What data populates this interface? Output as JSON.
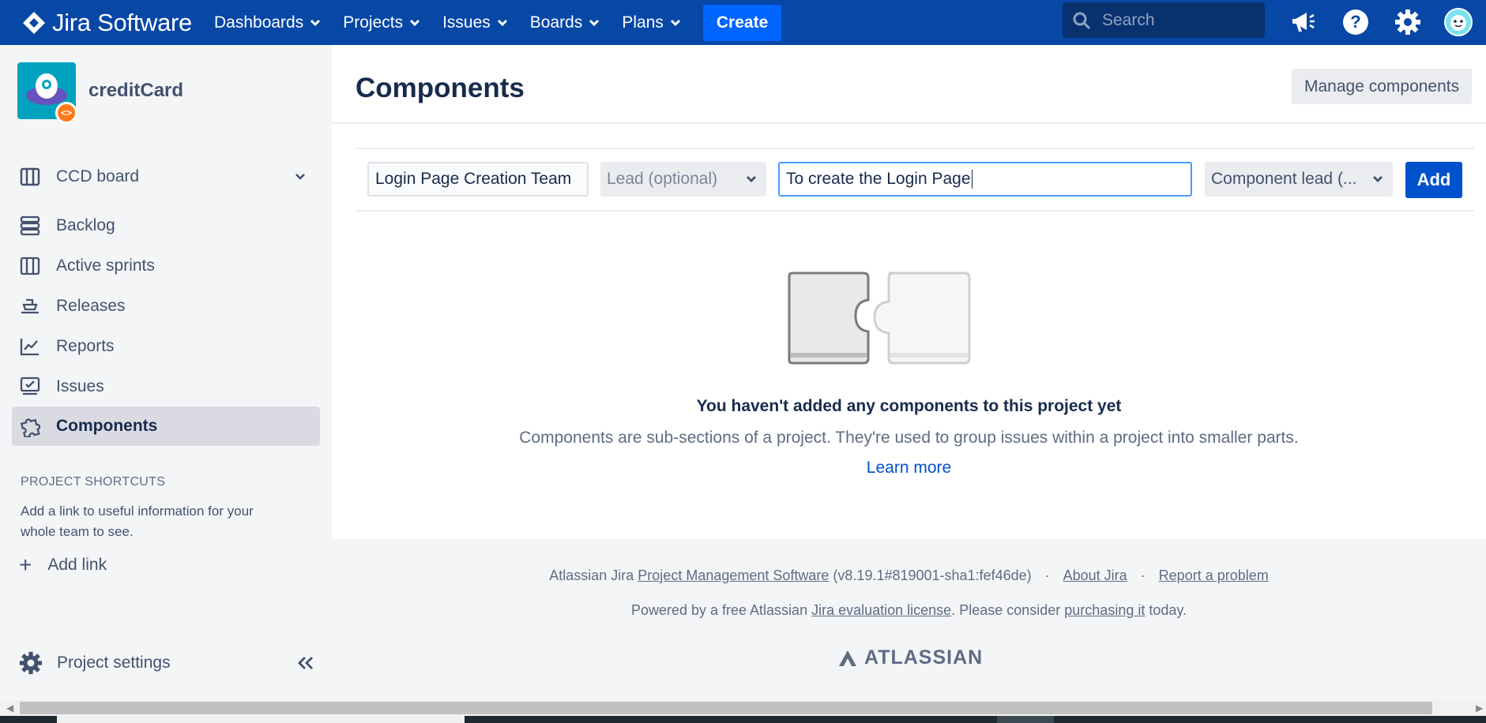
{
  "topnav": {
    "logo_text": "Jira Software",
    "menu": [
      {
        "label": "Dashboards"
      },
      {
        "label": "Projects"
      },
      {
        "label": "Issues"
      },
      {
        "label": "Boards"
      },
      {
        "label": "Plans"
      }
    ],
    "create_label": "Create",
    "search_placeholder": "Search"
  },
  "sidebar": {
    "project_name": "creditCard",
    "board_label": "CCD board",
    "items": [
      {
        "label": "Backlog",
        "icon": "backlog-icon"
      },
      {
        "label": "Active sprints",
        "icon": "sprint-board-icon"
      },
      {
        "label": "Releases",
        "icon": "ship-icon"
      },
      {
        "label": "Reports",
        "icon": "chart-icon"
      },
      {
        "label": "Issues",
        "icon": "issues-icon"
      },
      {
        "label": "Components",
        "icon": "puzzle-icon",
        "active": true
      }
    ],
    "shortcuts_title": "PROJECT SHORTCUTS",
    "shortcuts_desc": "Add a link to useful information for your whole team to see.",
    "add_link_label": "Add link",
    "settings_label": "Project settings"
  },
  "main": {
    "title": "Components",
    "manage_label": "Manage components",
    "form": {
      "name_value": "Login Page Creation Team",
      "lead_placeholder": "Lead (optional)",
      "description_value": "To create the Login Page",
      "component_lead_label": "Component lead (...",
      "add_label": "Add"
    },
    "empty": {
      "title": "You haven't added any components to this project yet",
      "description": "Components are sub-sections of a project. They're used to group issues within a project into smaller parts.",
      "learn_more": "Learn more"
    }
  },
  "footer": {
    "line1_prefix": "Atlassian Jira ",
    "line1_link1": "Project Management Software",
    "line1_version": " (v8.19.1#819001-sha1:fef46de)",
    "sep": " · ",
    "about_label": "About Jira",
    "report_label": "Report a problem",
    "line2_prefix": "Powered by a free Atlassian ",
    "line2_link1": "Jira evaluation license",
    "line2_mid": ". Please consider ",
    "line2_link2": "purchasing it",
    "line2_suffix": " today.",
    "brand": "ATLASSIAN"
  },
  "colors": {
    "nav_bg": "#0747a6",
    "create_bg": "#0065ff",
    "primary": "#0052cc",
    "sidebar_bg": "#f4f5f7",
    "active_item_bg": "#dadbe2",
    "focus_border": "#4c9aff"
  }
}
